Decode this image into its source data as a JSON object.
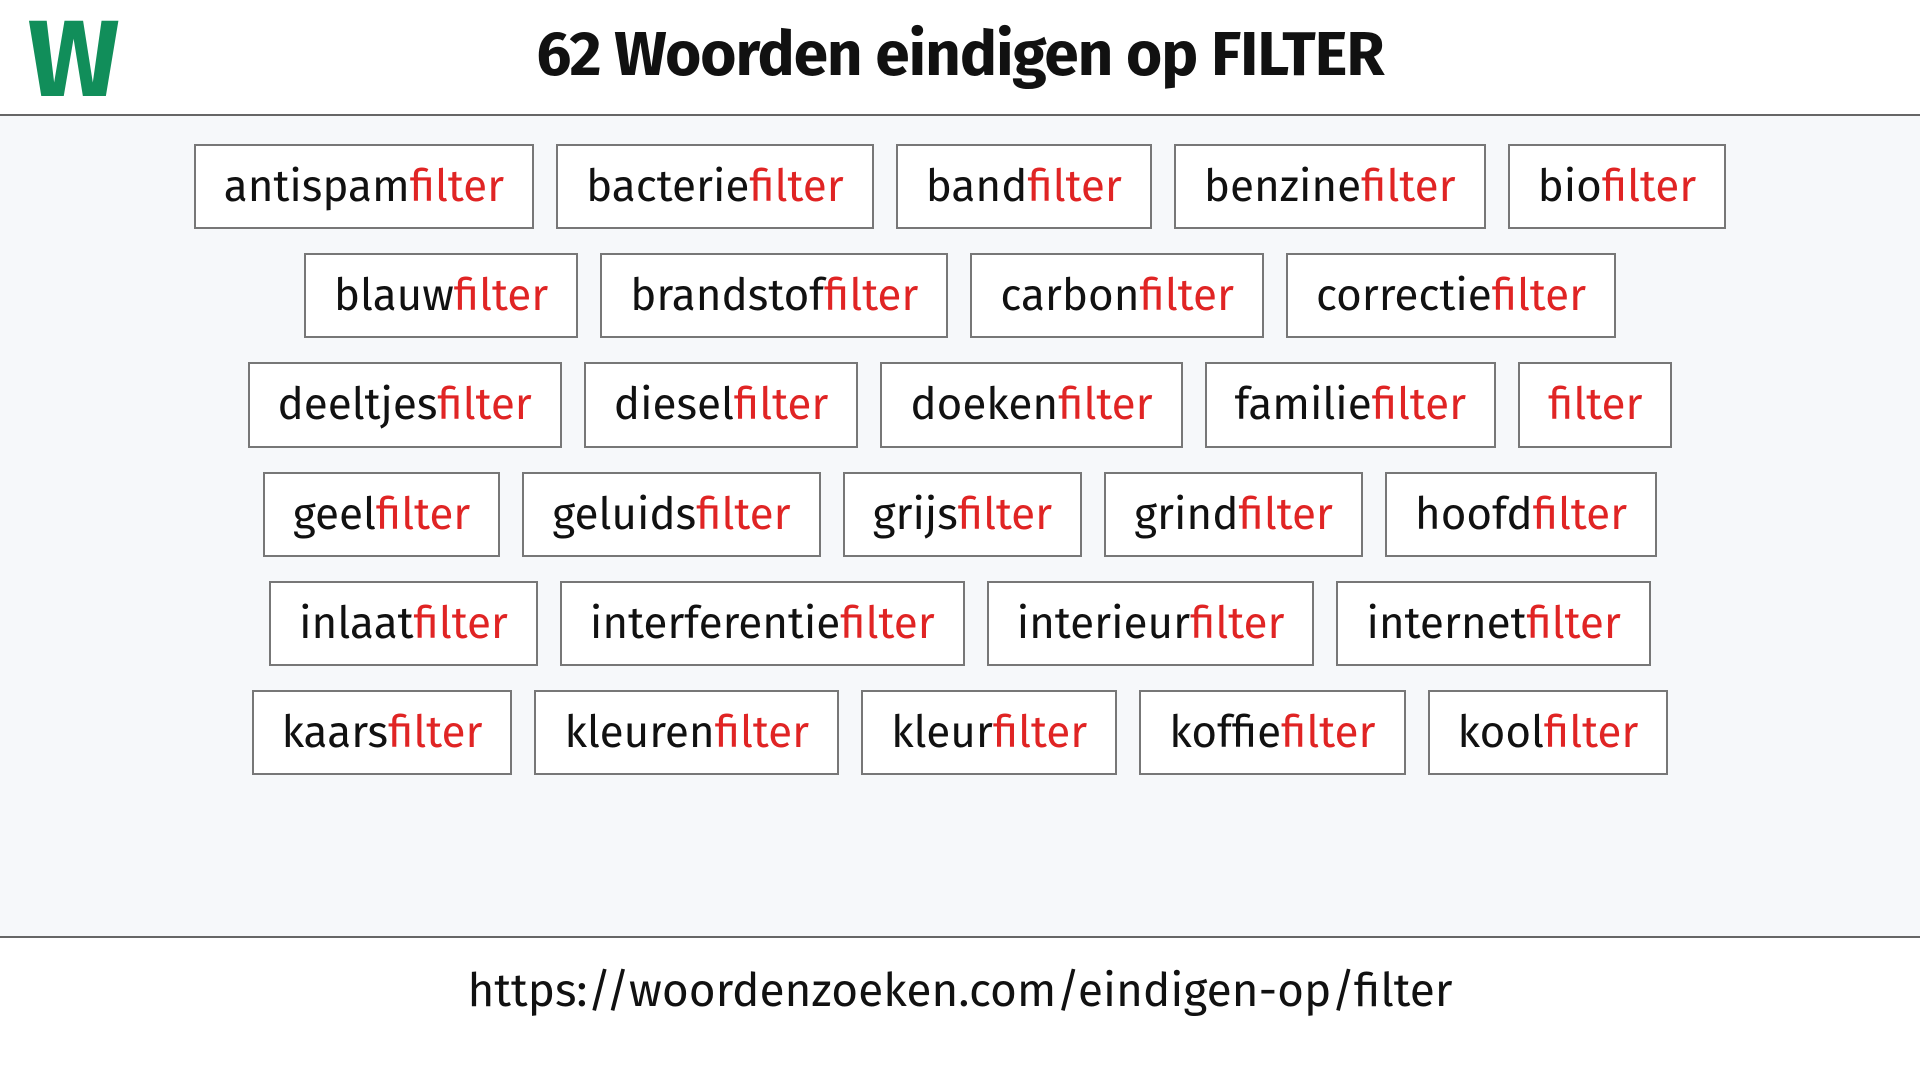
{
  "logo_letter": "W",
  "title": "62 Woorden eindigen op FILTER",
  "footer_url": "https://woordenzoeken.com/eindigen-op/filter",
  "suffix": "filter",
  "rows": [
    [
      {
        "prefix": "antispam"
      },
      {
        "prefix": "bacterie"
      },
      {
        "prefix": "band"
      },
      {
        "prefix": "benzine"
      },
      {
        "prefix": "bio"
      }
    ],
    [
      {
        "prefix": "blauw"
      },
      {
        "prefix": "brandstof"
      },
      {
        "prefix": "carbon"
      },
      {
        "prefix": "correctie"
      }
    ],
    [
      {
        "prefix": "deeltjes"
      },
      {
        "prefix": "diesel"
      },
      {
        "prefix": "doeken"
      },
      {
        "prefix": "familie"
      },
      {
        "prefix": ""
      }
    ],
    [
      {
        "prefix": "geel"
      },
      {
        "prefix": "geluids"
      },
      {
        "prefix": "grijs"
      },
      {
        "prefix": "grind"
      },
      {
        "prefix": "hoofd"
      }
    ],
    [
      {
        "prefix": "inlaat"
      },
      {
        "prefix": "interferentie"
      },
      {
        "prefix": "interieur"
      },
      {
        "prefix": "internet"
      }
    ],
    [
      {
        "prefix": "kaars"
      },
      {
        "prefix": "kleuren"
      },
      {
        "prefix": "kleur"
      },
      {
        "prefix": "koffie"
      },
      {
        "prefix": "kool"
      }
    ]
  ]
}
